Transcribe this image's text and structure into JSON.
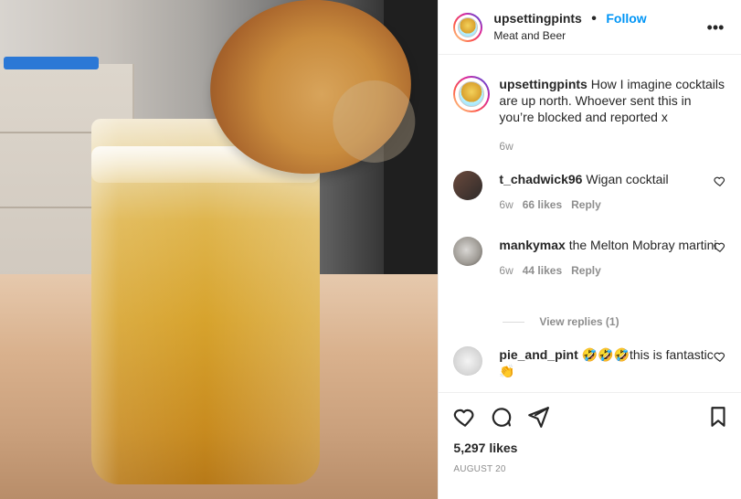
{
  "header": {
    "username": "upsettingpints",
    "follow_label": "Follow",
    "subtitle": "Meat and Beer",
    "more_label": "•••"
  },
  "caption": {
    "username": "upsettingpints",
    "text": "How I imagine cocktails are up north. Whoever sent this in you’re blocked and reported x",
    "time": "6w"
  },
  "comments": [
    {
      "username": "t_chadwick96",
      "text": "Wigan cocktail",
      "time": "6w",
      "likes": "66 likes",
      "reply": "Reply"
    },
    {
      "username": "mankymax",
      "text": "the Melton Mobray martini",
      "time": "6w",
      "likes": "44 likes",
      "reply": "Reply"
    },
    {
      "username": "pie_and_pint",
      "text": "🤣🤣🤣this is fantastic 👏"
    }
  ],
  "view_replies": "View replies (1)",
  "footer": {
    "likes": "5,297 likes",
    "date": "AUGUST 20"
  },
  "colors": {
    "accent": "#0095f6",
    "muted": "#8e8e8e",
    "border": "#efefef"
  },
  "icons": {
    "like": "heart-icon",
    "comment": "comment-icon",
    "share": "paper-plane-icon",
    "save": "bookmark-icon",
    "more": "more-icon"
  }
}
